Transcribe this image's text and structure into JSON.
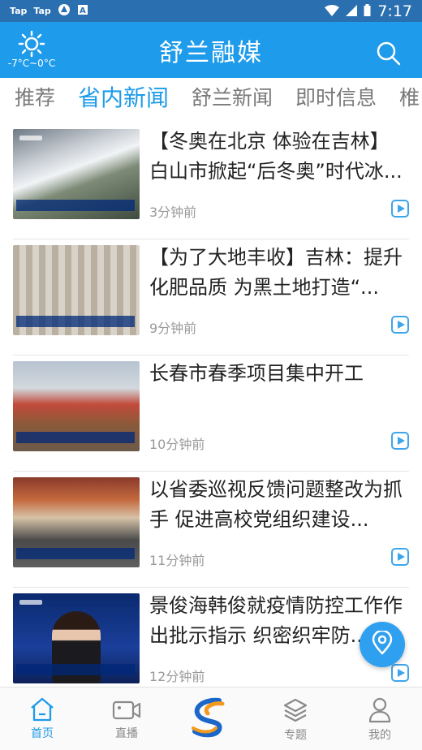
{
  "status_bar": {
    "left_items": [
      "Tap",
      "Tap"
    ],
    "time": "7:17",
    "icons": [
      "tap-icon",
      "tap-icon",
      "settings-icon",
      "a-icon",
      "wifi-icon",
      "signal-icon",
      "battery-icon"
    ]
  },
  "header": {
    "weather_temp": "-7°C~0°C",
    "weather_icon": "sun-icon",
    "title": "舒兰融媒",
    "search_icon": "search-icon"
  },
  "tabs": [
    {
      "label": "推荐",
      "active": false
    },
    {
      "label": "省内新闻",
      "active": true
    },
    {
      "label": "舒兰新闻",
      "active": false
    },
    {
      "label": "即时信息",
      "active": false
    },
    {
      "label": "椎",
      "active": false
    }
  ],
  "news": [
    {
      "title": "【冬奥在北京 体验在吉林】白山市掀起“后冬奥”时代冰...",
      "time": "3分钟前"
    },
    {
      "title": "【为了大地丰收】吉林：提升化肥品质 为黑土地打造“...",
      "time": "9分钟前"
    },
    {
      "title": "长春市春季项目集中开工",
      "time": "10分钟前"
    },
    {
      "title": "以省委巡视反馈问题整改为抓手 促进高校党组织建设...",
      "time": "11分钟前"
    },
    {
      "title": "景俊海韩俊就疫情防控工作作出批示指示 织密织牢防...",
      "time": "12分钟前"
    }
  ],
  "bottom_nav": [
    {
      "label": "首页",
      "icon": "home-icon",
      "active": true
    },
    {
      "label": "直播",
      "icon": "camera-icon",
      "active": false
    },
    {
      "label": "",
      "icon": "app-logo-icon",
      "active": false
    },
    {
      "label": "专题",
      "icon": "layers-icon",
      "active": false
    },
    {
      "label": "我的",
      "icon": "user-icon",
      "active": false
    }
  ],
  "colors": {
    "accent": "#1e9bea",
    "status_bar": "#2a6fb0"
  }
}
